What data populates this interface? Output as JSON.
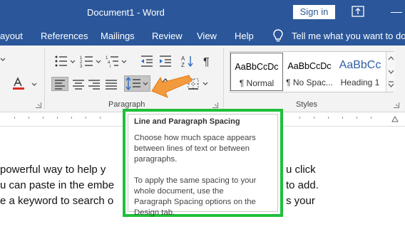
{
  "titlebar": {
    "document_title": "Document1  -  Word",
    "signin_label": "Sign in"
  },
  "menu": {
    "tabs": [
      "ayout",
      "References",
      "Mailings",
      "Review",
      "View",
      "Help"
    ],
    "tell_me": "Tell me what you want to do"
  },
  "ribbon": {
    "paragraph_group_label": "Paragraph",
    "styles_group_label": "Styles",
    "styles": [
      {
        "sample": "AaBbCcDc",
        "name": "¶ Normal",
        "selected": true
      },
      {
        "sample": "AaBbCcDc",
        "name": "¶ No Spac...",
        "selected": false
      },
      {
        "sample": "AaBbCc",
        "name": "Heading 1",
        "selected": false
      }
    ]
  },
  "document": {
    "lines": [
      " powerful way to help y",
      "u can paste in the embe",
      "e a keyword to search o"
    ],
    "right_fragments": [
      "u click",
      "to add.",
      "s your"
    ]
  },
  "tooltip": {
    "title": "Line and Paragraph Spacing",
    "lines": [
      "Choose how much space appears",
      "between lines of text or between",
      "paragraphs.",
      "",
      "To apply the same spacing to your",
      "whole document, use the",
      "Paragraph Spacing options on the",
      "Design tab."
    ]
  },
  "colors": {
    "word_blue": "#2b579a",
    "highlight_border": "#1ec03a",
    "arrow_orange": "#f39a3c",
    "font_color_red": "#e0281b"
  }
}
